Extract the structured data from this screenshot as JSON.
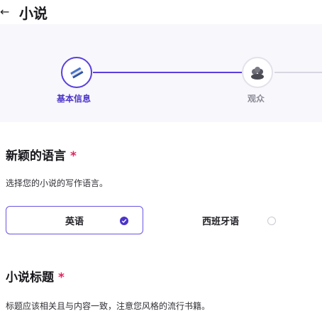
{
  "header": {
    "title": "小说"
  },
  "stepper": {
    "steps": [
      {
        "label": "基本信息",
        "state": "active",
        "icon": "book-icon"
      },
      {
        "label": "观众",
        "state": "inactive",
        "icon": "crowd-icon"
      }
    ],
    "colors": {
      "active": "#5a3fe0",
      "inactive": "#d8d6e2"
    }
  },
  "language": {
    "title": "新颖的语言",
    "required": "*",
    "helper": "选择您的小说的写作语言。",
    "options": [
      {
        "label": "英语",
        "selected": true
      },
      {
        "label": "西班牙语",
        "selected": false
      }
    ]
  },
  "novel_title": {
    "title": "小说标题",
    "required": "*",
    "helper": "标题应该相关且与内容一致，注意您风格的流行书籍。"
  }
}
